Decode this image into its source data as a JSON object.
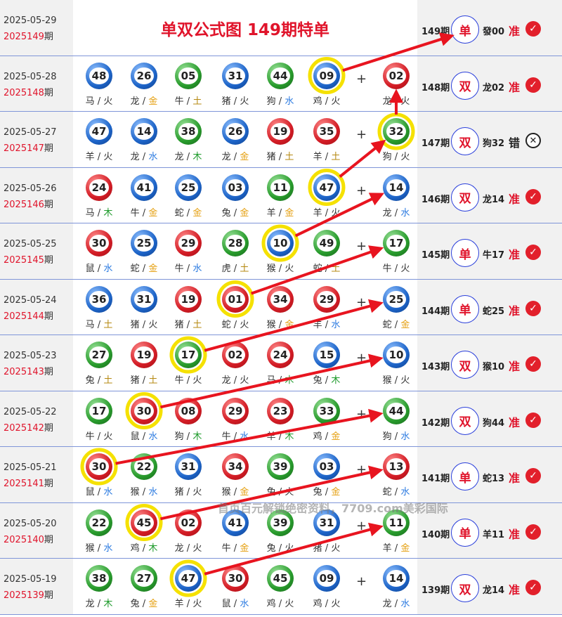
{
  "title": "单双公式图 149期特单",
  "watermark": "首页百元解锁绝密资料，7709.com美彩国际",
  "top": {
    "date": "2025-05-29",
    "issue_red": "2025149",
    "issue_suffix": "期",
    "right_issue": "149期",
    "parity": "单",
    "pred": "發00",
    "result": "准",
    "mark": "ok"
  },
  "rows": [
    {
      "date": "2025-05-28",
      "issue_red": "2025148",
      "issue_suffix": "期",
      "right_issue": "148期",
      "parity": "双",
      "pred": "龙02",
      "result": "准",
      "mark": "ok",
      "balls": [
        {
          "n": "48",
          "c": "blue",
          "z": "马",
          "e": "火"
        },
        {
          "n": "26",
          "c": "blue",
          "z": "龙",
          "e": "金"
        },
        {
          "n": "05",
          "c": "green",
          "z": "牛",
          "e": "土"
        },
        {
          "n": "31",
          "c": "blue",
          "z": "猪",
          "e": "火"
        },
        {
          "n": "44",
          "c": "green",
          "z": "狗",
          "e": "水"
        },
        {
          "n": "09",
          "c": "blue",
          "z": "鸡",
          "e": "火"
        },
        {
          "n": "02",
          "c": "red",
          "z": "龙",
          "e": "火"
        }
      ]
    },
    {
      "date": "2025-05-27",
      "issue_red": "2025147",
      "issue_suffix": "期",
      "right_issue": "147期",
      "parity": "双",
      "pred": "狗32",
      "result": "错",
      "mark": "bad",
      "balls": [
        {
          "n": "47",
          "c": "blue",
          "z": "羊",
          "e": "火"
        },
        {
          "n": "14",
          "c": "blue",
          "z": "龙",
          "e": "水"
        },
        {
          "n": "38",
          "c": "green",
          "z": "龙",
          "e": "木"
        },
        {
          "n": "26",
          "c": "blue",
          "z": "龙",
          "e": "金"
        },
        {
          "n": "19",
          "c": "red",
          "z": "猪",
          "e": "土"
        },
        {
          "n": "35",
          "c": "red",
          "z": "羊",
          "e": "土"
        },
        {
          "n": "32",
          "c": "green",
          "z": "狗",
          "e": "火"
        }
      ]
    },
    {
      "date": "2025-05-26",
      "issue_red": "2025146",
      "issue_suffix": "期",
      "right_issue": "146期",
      "parity": "双",
      "pred": "龙14",
      "result": "准",
      "mark": "ok",
      "balls": [
        {
          "n": "24",
          "c": "red",
          "z": "马",
          "e": "木"
        },
        {
          "n": "41",
          "c": "blue",
          "z": "牛",
          "e": "金"
        },
        {
          "n": "25",
          "c": "blue",
          "z": "蛇",
          "e": "金"
        },
        {
          "n": "03",
          "c": "blue",
          "z": "兔",
          "e": "金"
        },
        {
          "n": "11",
          "c": "green",
          "z": "羊",
          "e": "金"
        },
        {
          "n": "47",
          "c": "blue",
          "z": "羊",
          "e": "火"
        },
        {
          "n": "14",
          "c": "blue",
          "z": "龙",
          "e": "水"
        }
      ]
    },
    {
      "date": "2025-05-25",
      "issue_red": "2025145",
      "issue_suffix": "期",
      "right_issue": "145期",
      "parity": "单",
      "pred": "牛17",
      "result": "准",
      "mark": "ok",
      "balls": [
        {
          "n": "30",
          "c": "red",
          "z": "鼠",
          "e": "水"
        },
        {
          "n": "25",
          "c": "blue",
          "z": "蛇",
          "e": "金"
        },
        {
          "n": "29",
          "c": "red",
          "z": "牛",
          "e": "水"
        },
        {
          "n": "28",
          "c": "green",
          "z": "虎",
          "e": "土"
        },
        {
          "n": "10",
          "c": "blue",
          "z": "猴",
          "e": "火"
        },
        {
          "n": "49",
          "c": "green",
          "z": "蛇",
          "e": "土"
        },
        {
          "n": "17",
          "c": "green",
          "z": "牛",
          "e": "火"
        }
      ]
    },
    {
      "date": "2025-05-24",
      "issue_red": "2025144",
      "issue_suffix": "期",
      "right_issue": "144期",
      "parity": "单",
      "pred": "蛇25",
      "result": "准",
      "mark": "ok",
      "balls": [
        {
          "n": "36",
          "c": "blue",
          "z": "马",
          "e": "土"
        },
        {
          "n": "31",
          "c": "blue",
          "z": "猪",
          "e": "火"
        },
        {
          "n": "19",
          "c": "red",
          "z": "猪",
          "e": "土"
        },
        {
          "n": "01",
          "c": "red",
          "z": "蛇",
          "e": "火"
        },
        {
          "n": "34",
          "c": "red",
          "z": "猴",
          "e": "金"
        },
        {
          "n": "29",
          "c": "red",
          "z": "羊",
          "e": "水"
        },
        {
          "n": "25",
          "c": "blue",
          "z": "蛇",
          "e": "金"
        }
      ]
    },
    {
      "date": "2025-05-23",
      "issue_red": "2025143",
      "issue_suffix": "期",
      "right_issue": "143期",
      "parity": "双",
      "pred": "猴10",
      "result": "准",
      "mark": "ok",
      "balls": [
        {
          "n": "27",
          "c": "green",
          "z": "兔",
          "e": "土"
        },
        {
          "n": "19",
          "c": "red",
          "z": "猪",
          "e": "土"
        },
        {
          "n": "17",
          "c": "green",
          "z": "牛",
          "e": "火"
        },
        {
          "n": "02",
          "c": "red",
          "z": "龙",
          "e": "火"
        },
        {
          "n": "24",
          "c": "red",
          "z": "马",
          "e": "木"
        },
        {
          "n": "15",
          "c": "blue",
          "z": "兔",
          "e": "木"
        },
        {
          "n": "10",
          "c": "blue",
          "z": "猴",
          "e": "火"
        }
      ]
    },
    {
      "date": "2025-05-22",
      "issue_red": "2025142",
      "issue_suffix": "期",
      "right_issue": "142期",
      "parity": "双",
      "pred": "狗44",
      "result": "准",
      "mark": "ok",
      "balls": [
        {
          "n": "17",
          "c": "green",
          "z": "牛",
          "e": "火"
        },
        {
          "n": "30",
          "c": "red",
          "z": "鼠",
          "e": "水"
        },
        {
          "n": "08",
          "c": "red",
          "z": "狗",
          "e": "木"
        },
        {
          "n": "29",
          "c": "red",
          "z": "牛",
          "e": "水"
        },
        {
          "n": "23",
          "c": "red",
          "z": "羊",
          "e": "木"
        },
        {
          "n": "33",
          "c": "green",
          "z": "鸡",
          "e": "金"
        },
        {
          "n": "44",
          "c": "green",
          "z": "狗",
          "e": "水"
        }
      ]
    },
    {
      "date": "2025-05-21",
      "issue_red": "2025141",
      "issue_suffix": "期",
      "right_issue": "141期",
      "parity": "单",
      "pred": "蛇13",
      "result": "准",
      "mark": "ok",
      "balls": [
        {
          "n": "30",
          "c": "red",
          "z": "鼠",
          "e": "水"
        },
        {
          "n": "22",
          "c": "green",
          "z": "猴",
          "e": "水"
        },
        {
          "n": "31",
          "c": "blue",
          "z": "猪",
          "e": "火"
        },
        {
          "n": "34",
          "c": "red",
          "z": "猴",
          "e": "金"
        },
        {
          "n": "39",
          "c": "green",
          "z": "兔",
          "e": "火"
        },
        {
          "n": "03",
          "c": "blue",
          "z": "兔",
          "e": "金"
        },
        {
          "n": "13",
          "c": "red",
          "z": "蛇",
          "e": "水"
        }
      ]
    },
    {
      "date": "2025-05-20",
      "issue_red": "2025140",
      "issue_suffix": "期",
      "right_issue": "140期",
      "parity": "单",
      "pred": "羊11",
      "result": "准",
      "mark": "ok",
      "balls": [
        {
          "n": "22",
          "c": "green",
          "z": "猴",
          "e": "水"
        },
        {
          "n": "45",
          "c": "red",
          "z": "鸡",
          "e": "木"
        },
        {
          "n": "02",
          "c": "red",
          "z": "龙",
          "e": "火"
        },
        {
          "n": "41",
          "c": "blue",
          "z": "牛",
          "e": "金"
        },
        {
          "n": "39",
          "c": "green",
          "z": "兔",
          "e": "火"
        },
        {
          "n": "31",
          "c": "blue",
          "z": "猪",
          "e": "火"
        },
        {
          "n": "11",
          "c": "green",
          "z": "羊",
          "e": "金"
        }
      ]
    },
    {
      "date": "2025-05-19",
      "issue_red": "2025139",
      "issue_suffix": "期",
      "right_issue": "139期",
      "parity": "双",
      "pred": "龙14",
      "result": "准",
      "mark": "ok",
      "balls": [
        {
          "n": "38",
          "c": "green",
          "z": "龙",
          "e": "木"
        },
        {
          "n": "27",
          "c": "green",
          "z": "兔",
          "e": "金"
        },
        {
          "n": "47",
          "c": "blue",
          "z": "羊",
          "e": "火"
        },
        {
          "n": "30",
          "c": "red",
          "z": "鼠",
          "e": "水"
        },
        {
          "n": "45",
          "c": "green",
          "z": "鸡",
          "e": "火"
        },
        {
          "n": "09",
          "c": "blue",
          "z": "鸡",
          "e": "火"
        },
        {
          "n": "14",
          "c": "blue",
          "z": "龙",
          "e": "水"
        }
      ]
    }
  ],
  "highlights": [
    {
      "row": 0,
      "col": 5
    },
    {
      "row": 1,
      "col": 6
    },
    {
      "row": 2,
      "col": 5
    },
    {
      "row": 3,
      "col": 4
    },
    {
      "row": 4,
      "col": 3
    },
    {
      "row": 5,
      "col": 2
    },
    {
      "row": 6,
      "col": 1
    },
    {
      "row": 7,
      "col": 0
    },
    {
      "row": 8,
      "col": 1
    },
    {
      "row": 9,
      "col": 2
    }
  ],
  "plus_sign": "+",
  "colors": {
    "accent": "#e0142b",
    "border": "#7f95d8",
    "panel": "#f1f1f1",
    "arrow": "#e8141f",
    "ring": "#f5e100"
  }
}
